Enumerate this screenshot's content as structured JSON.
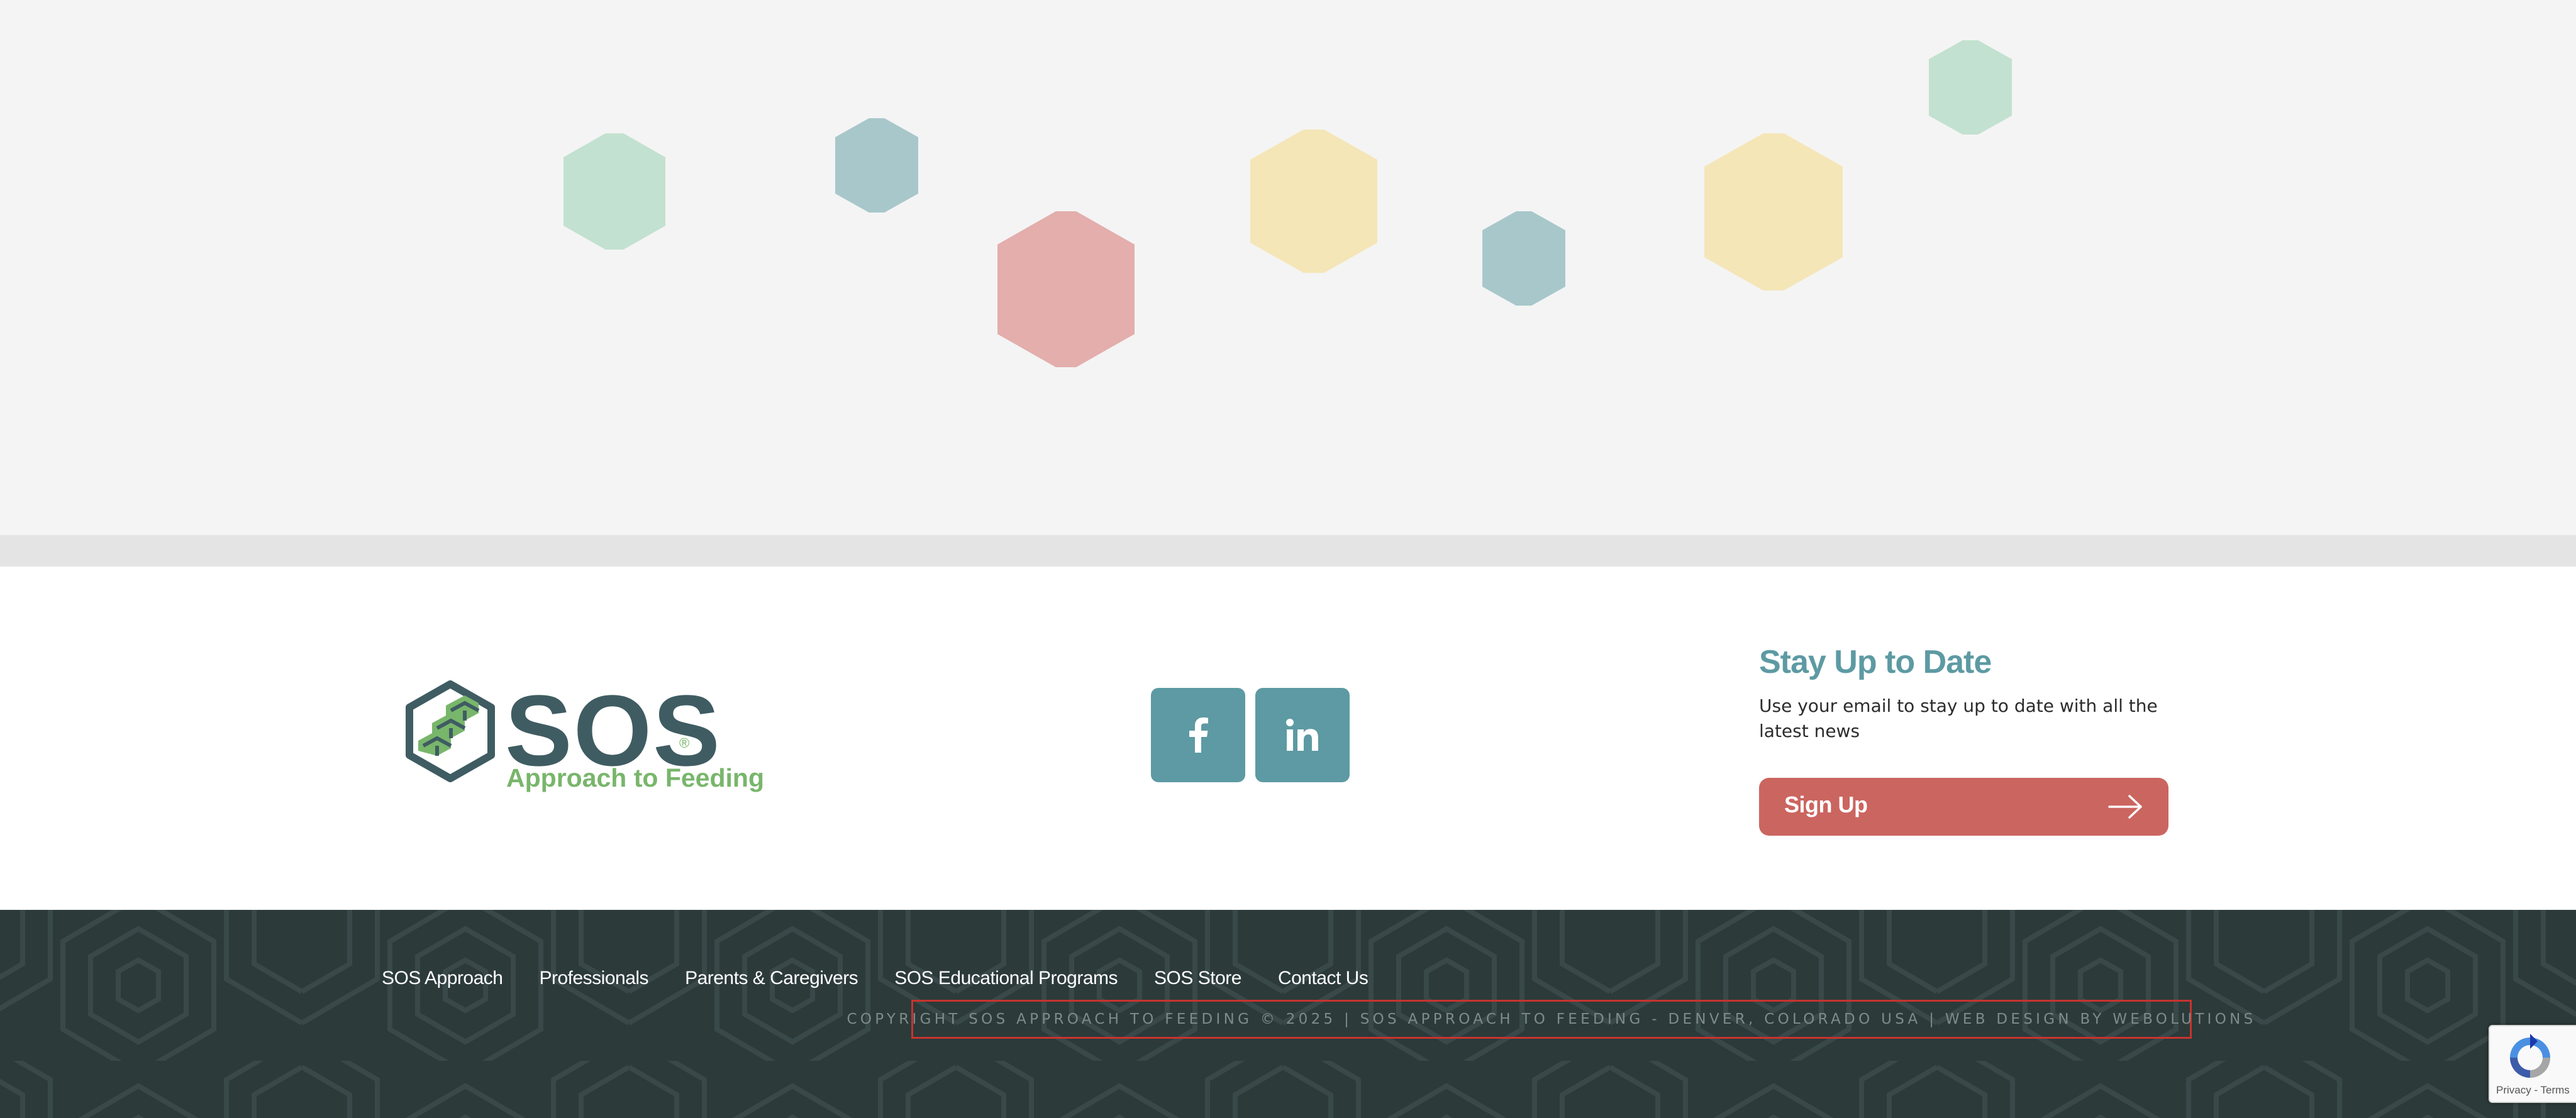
{
  "brand": {
    "logo_word": "SOS",
    "logo_registered": "®",
    "logo_tagline": "Approach to Feeding",
    "primary_color": "#3f5c62",
    "accent_green": "#78b66b",
    "teal": "#5d9aa3",
    "coral": "#cb6560"
  },
  "social": {
    "facebook_label": "f",
    "linkedin_label": "in"
  },
  "newsletter": {
    "title": "Stay Up to Date",
    "description": "Use your email to stay up to date with all the latest news",
    "button_label": "Sign Up"
  },
  "footer": {
    "nav": [
      {
        "label": "SOS Approach"
      },
      {
        "label": "Professionals"
      },
      {
        "label": "Parents & Caregivers"
      },
      {
        "label": "SOS Educational Programs"
      },
      {
        "label": "SOS Store"
      },
      {
        "label": "Contact Us"
      }
    ],
    "copyright": "COPYRIGHT SOS APPROACH TO FEEDING © 2025 | SOS APPROACH TO FEEDING - DENVER, COLORADO USA | WEB DESIGN BY WEBOLUTIONS"
  },
  "recaptcha": {
    "links": "Privacy - Terms"
  },
  "hexagons": {
    "colors": [
      "#c3e1d0",
      "#a8c7cb",
      "#e3aeac",
      "#f5e6b8"
    ]
  }
}
